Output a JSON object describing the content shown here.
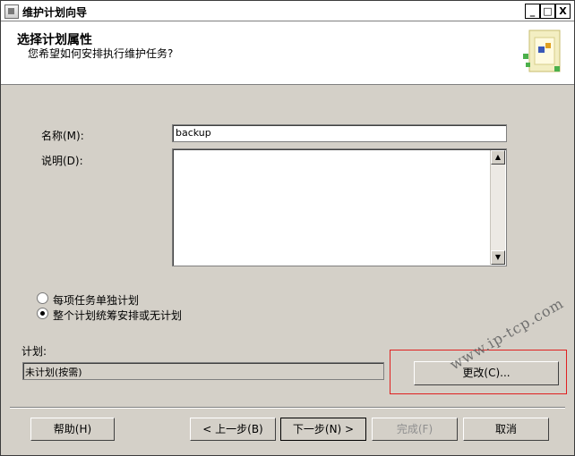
{
  "window": {
    "title": "维护计划向导",
    "controls": {
      "minimize": "_",
      "maximize": "□",
      "close": "X"
    }
  },
  "header": {
    "title": "选择计划属性",
    "subtitle": "您希望如何安排执行维护任务?",
    "graphic_icon": "wizard-graphic-icon"
  },
  "form": {
    "name_label": "名称(M):",
    "name_value": "backup",
    "description_label": "说明(D):",
    "description_value": "",
    "options": [
      {
        "label": "每项任务单独计划",
        "selected": false
      },
      {
        "label": "整个计划统筹安排或无计划",
        "selected": true
      }
    ],
    "schedule_label": "计划:",
    "schedule_value": "未计划(按需)",
    "change_button": "更改(C)..."
  },
  "footer": {
    "help": "帮助(H)",
    "back": "< 上一步(B)",
    "next": "下一步(N) >",
    "finish": "完成(F)",
    "cancel": "取消"
  },
  "watermark": "www.ip-tcp.com"
}
